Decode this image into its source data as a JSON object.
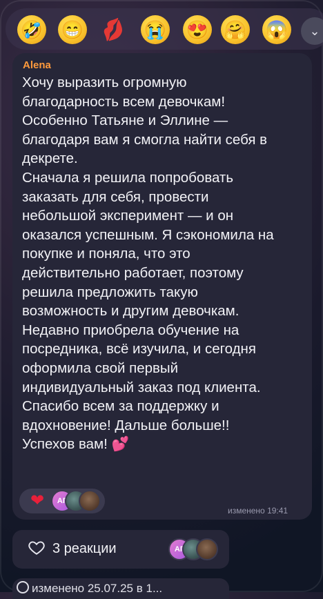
{
  "reaction_picker": {
    "emojis": [
      {
        "name": "rolling-laughing-emoji-icon",
        "glyph": "🤣"
      },
      {
        "name": "grinning-emoji-icon",
        "glyph": "😁"
      },
      {
        "name": "kiss-lips-emoji-icon",
        "glyph": "💋"
      },
      {
        "name": "crying-emoji-icon",
        "glyph": "😭"
      },
      {
        "name": "heart-eyes-emoji-icon",
        "glyph": "😍"
      },
      {
        "name": "hugging-emoji-icon",
        "glyph": "🤗"
      },
      {
        "name": "screaming-emoji-icon",
        "glyph": "😱"
      }
    ],
    "expand_glyph": "⌄"
  },
  "message": {
    "author": "Alena",
    "text": "Хочу выразить огромную\nблагодарность всем девочкам!\nОсобенно Татьяне и Эллине —\nблагодаря вам я смогла найти себя в\nдекрете.\nСначала я решила попробовать\nзаказать для себя, провести\nнебольшой эксперимент — и он\nоказался успешным. Я сэкономила на\nпокупке и поняла, что это\nдействительно работает, поэтому\nрешила предложить такую\nвозможность и другим девочкам.\nНедавно приобрела обучение на\nпосредника, всё изучила, и сегодня\nоформила свой первый\nиндивидуальный заказ под клиента.\nСпасибо всем за поддержку и\nвдохновение! Дальше больше!!\nУспехов вам!",
    "trailing_emoji": "💕",
    "reaction_emoji": "❤",
    "avatar_initials": "АГ",
    "edited": "изменено 19:41"
  },
  "summary": {
    "reactions_label": "3 реакции",
    "avatar_initials": "АГ",
    "edited_label": "изменено 25.07.25 в 1..."
  }
}
